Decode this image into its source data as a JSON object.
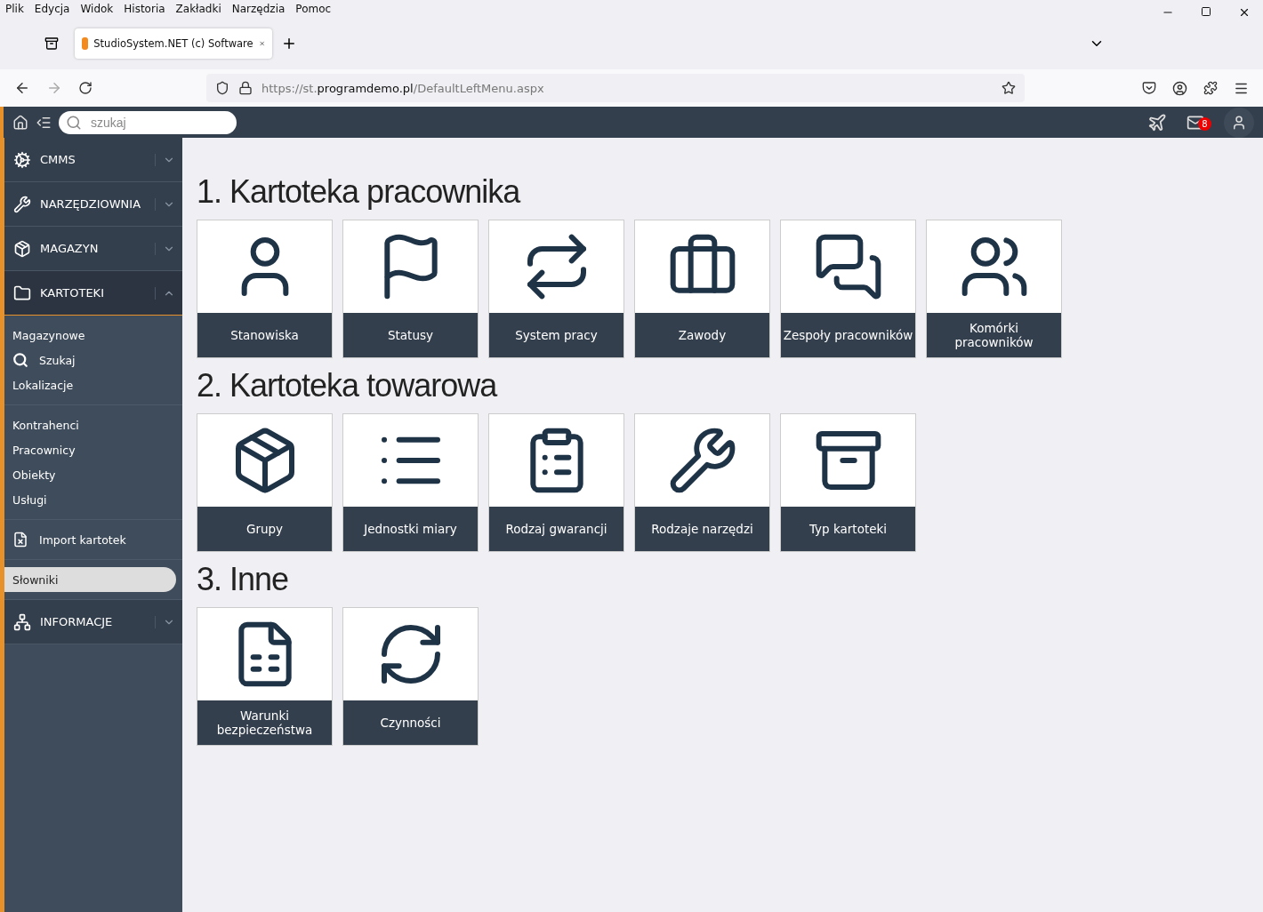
{
  "menu_bar": [
    "Plik",
    "Edycja",
    "Widok",
    "Historia",
    "Zakładki",
    "Narzędzia",
    "Pomoc"
  ],
  "tab": {
    "title": "StudioSystem.NET (c) Software",
    "selected": true
  },
  "address": {
    "prefix": "https://st.",
    "domain": "programdemo.pl",
    "path": "/DefaultLeftMenu.aspx"
  },
  "app_bar": {
    "search": {
      "placeholder": "szukaj"
    },
    "mail_badge": "8"
  },
  "sidebar": [
    {
      "label": "CMMS",
      "expanded": false
    },
    {
      "label": "NARZĘDZIOWNIA",
      "expanded": false
    },
    {
      "label": "MAGAZYN",
      "expanded": false
    },
    {
      "label": "KARTOTEKI",
      "expanded": true,
      "children": [
        [
          {
            "kind": "link",
            "label": "Magazynowe",
            "selected": false
          },
          {
            "kind": "search",
            "label": "Szukaj",
            "selected": false
          },
          {
            "kind": "link",
            "label": "Lokalizacje",
            "selected": false
          }
        ],
        [
          {
            "kind": "link",
            "label": "Kontrahenci",
            "selected": false
          },
          {
            "kind": "link",
            "label": "Pracownicy",
            "selected": false
          },
          {
            "kind": "link",
            "label": "Obiekty",
            "selected": false
          },
          {
            "kind": "link",
            "label": "Usługi",
            "selected": false
          }
        ],
        [
          {
            "kind": "import",
            "label": "Import kartotek",
            "selected": false
          }
        ],
        [
          {
            "kind": "link",
            "label": "Słowniki",
            "selected": true
          }
        ]
      ]
    },
    {
      "label": "INFORMACJE",
      "expanded": false
    }
  ],
  "sections": [
    {
      "title": "1. Kartoteka pracownika",
      "tiles": [
        "Stanowiska",
        "Statusy",
        "System pracy",
        "Zawody",
        "Zespoły pracowników",
        "Komórki pracowników"
      ]
    },
    {
      "title": "2. Kartoteka towarowa",
      "tiles": [
        "Grupy",
        "Jednostki miary",
        "Rodzaj gwarancji",
        "Rodzaje narzędzi",
        "Typ kartoteki"
      ]
    },
    {
      "title": "3. Inne",
      "tiles": [
        "Warunki bezpieczeństwa",
        "Czynności"
      ]
    }
  ]
}
